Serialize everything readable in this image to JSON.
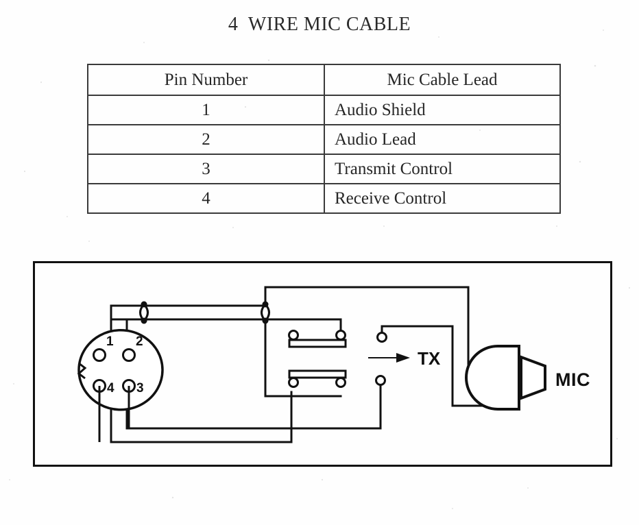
{
  "document": {
    "title": "4  WIRE MIC CABLE"
  },
  "pin_table": {
    "headers": {
      "pin": "Pin Number",
      "lead": "Mic Cable Lead"
    },
    "rows": [
      {
        "pin": "1",
        "lead": "Audio Shield"
      },
      {
        "pin": "2",
        "lead": "Audio Lead"
      },
      {
        "pin": "3",
        "lead": "Transmit Control"
      },
      {
        "pin": "4",
        "lead": "Receive Control"
      }
    ]
  },
  "diagram": {
    "connector": {
      "name": "4-pin circular connector",
      "pins": [
        {
          "number": "1",
          "position": "top-left"
        },
        {
          "number": "2",
          "position": "top-right"
        },
        {
          "number": "3",
          "position": "bottom-right"
        },
        {
          "number": "4",
          "position": "bottom-left"
        }
      ]
    },
    "labels": {
      "tx": "TX",
      "mic": "MIC"
    },
    "colors": {
      "line": "#111111",
      "background": "#fefefe",
      "table_border": "#3a3a3a",
      "text": "#262626"
    }
  }
}
